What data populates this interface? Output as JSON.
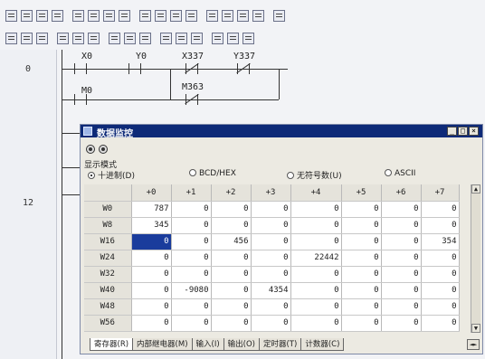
{
  "toolbar": {
    "row1_icons": [
      "new-file-icon",
      "open-icon",
      "save-icon",
      "print-icon",
      "view-icon",
      "window-icon",
      "find-icon",
      "undo-icon",
      "redo-icon",
      "replace-icon",
      "read-plc-icon",
      "write-plc-icon",
      "zoom-icon",
      "ladder-view-icon",
      "list-view-icon",
      "monitor-start-icon",
      "monitor-stop-icon"
    ],
    "row2_icons": [
      "open-contact-icon",
      "closed-contact-icon",
      "parallel-open-icon",
      "parallel-closed-icon",
      "rise-icon",
      "fall-icon",
      "coil-icon",
      "function-icon",
      "hline-icon",
      "vline-icon",
      "delete-line-icon",
      "invert-icon",
      "convert-icon",
      "step-icon",
      "cut-icon"
    ]
  },
  "ladder": {
    "step_numbers": [
      "0",
      "12"
    ],
    "contacts": [
      "X0",
      "Y0",
      "X337",
      "Y337",
      "M0",
      "M363"
    ]
  },
  "dialog": {
    "title": "数据监控",
    "window_buttons": [
      "_",
      "□",
      "×"
    ],
    "display_mode_label": "显示模式",
    "radio_options": [
      {
        "label": "十进制(D)",
        "selected": true
      },
      {
        "label": "BCD/HEX",
        "selected": false
      },
      {
        "label": "无符号数(U)",
        "selected": false
      },
      {
        "label": "ASCII",
        "selected": false
      }
    ],
    "columns": [
      "",
      "+0",
      "+1",
      "+2",
      "+3",
      "+4",
      "+5",
      "+6",
      "+7"
    ],
    "rows": [
      {
        "addr": "W0",
        "values": [
          "787",
          "0",
          "0",
          "0",
          "0",
          "0",
          "0",
          "0"
        ]
      },
      {
        "addr": "W8",
        "values": [
          "345",
          "0",
          "0",
          "0",
          "0",
          "0",
          "0",
          "0"
        ]
      },
      {
        "addr": "W16",
        "values": [
          "0",
          "0",
          "456",
          "0",
          "0",
          "0",
          "0",
          "354"
        ]
      },
      {
        "addr": "W24",
        "values": [
          "0",
          "0",
          "0",
          "0",
          "22442",
          "0",
          "0",
          "0"
        ]
      },
      {
        "addr": "W32",
        "values": [
          "0",
          "0",
          "0",
          "0",
          "0",
          "0",
          "0",
          "0"
        ]
      },
      {
        "addr": "W40",
        "values": [
          "0",
          "-9080",
          "0",
          "4354",
          "0",
          "0",
          "0",
          "0"
        ]
      },
      {
        "addr": "W48",
        "values": [
          "0",
          "0",
          "0",
          "0",
          "0",
          "0",
          "0",
          "0"
        ]
      },
      {
        "addr": "W56",
        "values": [
          "0",
          "0",
          "0",
          "0",
          "0",
          "0",
          "0",
          "0"
        ]
      }
    ],
    "selected_cell": {
      "row": 2,
      "col": 0
    },
    "tabs": [
      "寄存器(R)",
      "内部继电器(M)",
      "输入(I)",
      "输出(O)",
      "定时器(T)",
      "计数器(C)"
    ],
    "active_tab": 0
  }
}
